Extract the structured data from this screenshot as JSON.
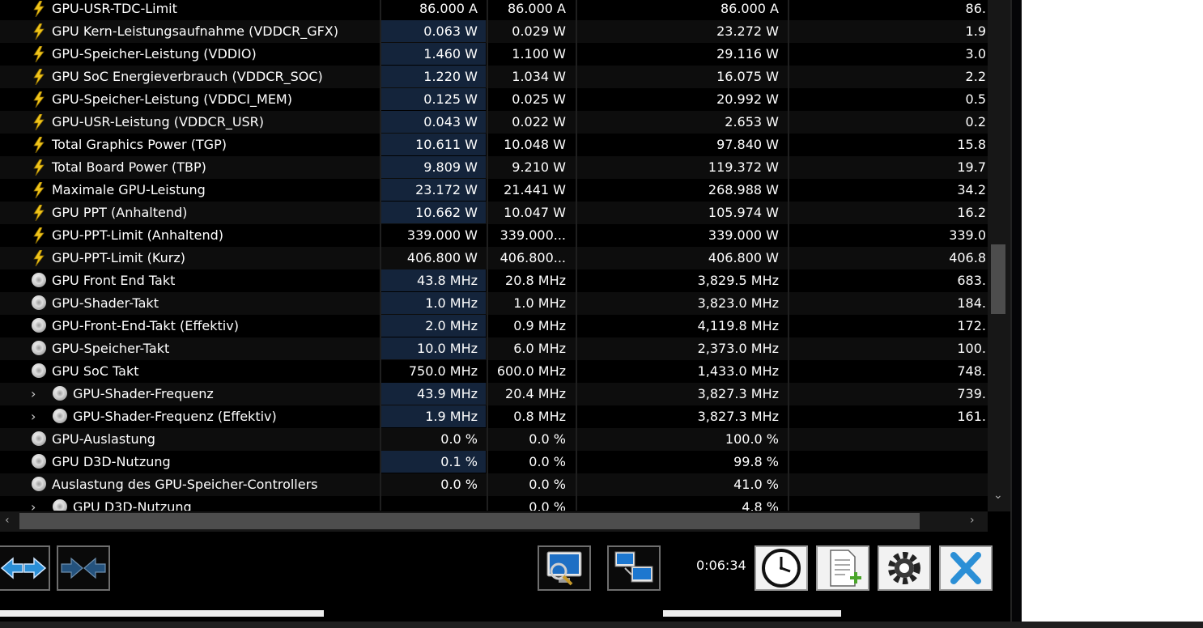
{
  "rows": [
    {
      "icon": "bolt",
      "expand": false,
      "name": "GPU-USR-TDC-Limit",
      "v1": "86.000 A",
      "v2": "86.000 A",
      "v3": "86.000 A",
      "v4": "86.",
      "hl": false
    },
    {
      "icon": "bolt",
      "expand": false,
      "name": "GPU Kern-Leistungsaufnahme (VDDCR_GFX)",
      "v1": "0.063 W",
      "v2": "0.029 W",
      "v3": "23.272 W",
      "v4": "1.9",
      "hl": true
    },
    {
      "icon": "bolt",
      "expand": false,
      "name": "GPU-Speicher-Leistung (VDDIO)",
      "v1": "1.460 W",
      "v2": "1.100 W",
      "v3": "29.116 W",
      "v4": "3.0",
      "hl": true
    },
    {
      "icon": "bolt",
      "expand": false,
      "name": "GPU SoC Energieverbrauch (VDDCR_SOC)",
      "v1": "1.220 W",
      "v2": "1.034 W",
      "v3": "16.075 W",
      "v4": "2.2",
      "hl": true
    },
    {
      "icon": "bolt",
      "expand": false,
      "name": "GPU-Speicher-Leistung (VDDCI_MEM)",
      "v1": "0.125 W",
      "v2": "0.025 W",
      "v3": "20.992 W",
      "v4": "0.5",
      "hl": true
    },
    {
      "icon": "bolt",
      "expand": false,
      "name": "GPU-USR-Leistung (VDDCR_USR)",
      "v1": "0.043 W",
      "v2": "0.022 W",
      "v3": "2.653 W",
      "v4": "0.2",
      "hl": true
    },
    {
      "icon": "bolt",
      "expand": false,
      "name": "Total Graphics Power (TGP)",
      "v1": "10.611 W",
      "v2": "10.048 W",
      "v3": "97.840 W",
      "v4": "15.8",
      "hl": true
    },
    {
      "icon": "bolt",
      "expand": false,
      "name": "Total Board Power (TBP)",
      "v1": "9.809 W",
      "v2": "9.210 W",
      "v3": "119.372 W",
      "v4": "19.7",
      "hl": true
    },
    {
      "icon": "bolt",
      "expand": false,
      "name": "Maximale GPU-Leistung",
      "v1": "23.172 W",
      "v2": "21.441 W",
      "v3": "268.988 W",
      "v4": "34.2",
      "hl": true
    },
    {
      "icon": "bolt",
      "expand": false,
      "name": "GPU PPT (Anhaltend)",
      "v1": "10.662 W",
      "v2": "10.047 W",
      "v3": "105.974 W",
      "v4": "16.2",
      "hl": true
    },
    {
      "icon": "bolt",
      "expand": false,
      "name": "GPU-PPT-Limit (Anhaltend)",
      "v1": "339.000 W",
      "v2": "339.000...",
      "v3": "339.000 W",
      "v4": "339.0",
      "hl": false
    },
    {
      "icon": "bolt",
      "expand": false,
      "name": "GPU-PPT-Limit (Kurz)",
      "v1": "406.800 W",
      "v2": "406.800...",
      "v3": "406.800 W",
      "v4": "406.8",
      "hl": false
    },
    {
      "icon": "clock",
      "expand": false,
      "name": "GPU Front End Takt",
      "v1": "43.8 MHz",
      "v2": "20.8 MHz",
      "v3": "3,829.5 MHz",
      "v4": "683.",
      "hl": true
    },
    {
      "icon": "clock",
      "expand": false,
      "name": "GPU-Shader-Takt",
      "v1": "1.0 MHz",
      "v2": "1.0 MHz",
      "v3": "3,823.0 MHz",
      "v4": "184.",
      "hl": true
    },
    {
      "icon": "clock",
      "expand": false,
      "name": "GPU-Front-End-Takt (Effektiv)",
      "v1": "2.0 MHz",
      "v2": "0.9 MHz",
      "v3": "4,119.8 MHz",
      "v4": "172.",
      "hl": true
    },
    {
      "icon": "clock",
      "expand": false,
      "name": "GPU-Speicher-Takt",
      "v1": "10.0 MHz",
      "v2": "6.0 MHz",
      "v3": "2,373.0 MHz",
      "v4": "100.",
      "hl": true
    },
    {
      "icon": "clock",
      "expand": false,
      "name": "GPU SoC Takt",
      "v1": "750.0 MHz",
      "v2": "600.0 MHz",
      "v3": "1,433.0 MHz",
      "v4": "748.",
      "hl": false
    },
    {
      "icon": "clock",
      "expand": true,
      "name": "GPU-Shader-Frequenz",
      "v1": "43.9 MHz",
      "v2": "20.4 MHz",
      "v3": "3,827.3 MHz",
      "v4": "739.",
      "hl": true
    },
    {
      "icon": "clock",
      "expand": true,
      "name": "GPU-Shader-Frequenz (Effektiv)",
      "v1": "1.9 MHz",
      "v2": "0.8 MHz",
      "v3": "3,827.3 MHz",
      "v4": "161.",
      "hl": true
    },
    {
      "icon": "clock",
      "expand": false,
      "name": "GPU-Auslastung",
      "v1": "0.0 %",
      "v2": "0.0 %",
      "v3": "100.0 %",
      "v4": "",
      "hl": false
    },
    {
      "icon": "clock",
      "expand": false,
      "name": "GPU D3D-Nutzung",
      "v1": "0.1 %",
      "v2": "0.0 %",
      "v3": "99.8 %",
      "v4": "",
      "hl": true
    },
    {
      "icon": "clock",
      "expand": false,
      "name": "Auslastung des GPU-Speicher-Controllers",
      "v1": "0.0 %",
      "v2": "0.0 %",
      "v3": "41.0 %",
      "v4": "",
      "hl": false
    },
    {
      "icon": "clock",
      "expand": true,
      "name": "GPU D3D-Nutzung",
      "v1": "",
      "v2": "0.0 %",
      "v3": "4.8 %",
      "v4": "",
      "hl": false
    }
  ],
  "footer": {
    "elapsed_time": "0:06:34",
    "buttons": [
      "expand-arrows-icon",
      "collapse-arrows-icon",
      "monitor-search-icon",
      "network-computers-icon",
      "clock-icon",
      "add-report-icon",
      "gear-icon",
      "close-x-icon"
    ]
  },
  "colors": {
    "highlight": "#14243b",
    "bolt": "#f0c419",
    "accent_blue": "#2b8fd6"
  }
}
